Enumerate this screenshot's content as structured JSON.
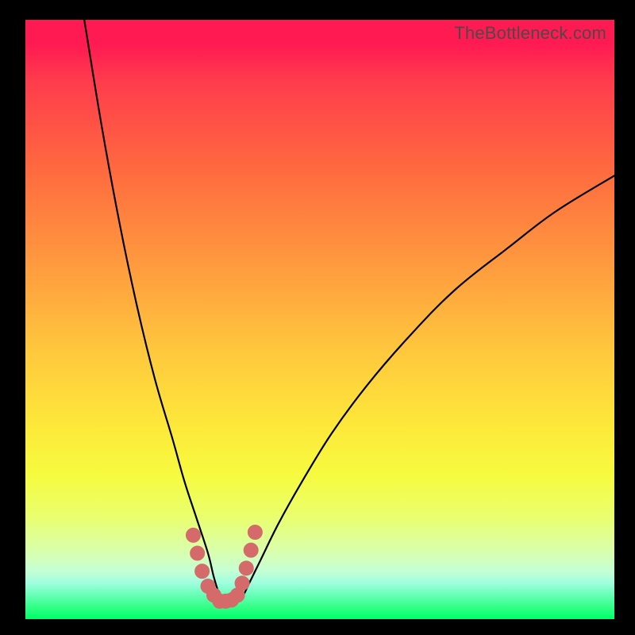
{
  "watermark": {
    "text": "TheBottleneck.com"
  },
  "colors": {
    "curve_stroke": "#000000",
    "marker_fill": "#d46a6a",
    "marker_stroke": "#d46a6a"
  },
  "chart_data": {
    "type": "line",
    "title": "",
    "xlabel": "",
    "ylabel": "",
    "xlim": [
      0,
      100
    ],
    "ylim": [
      0,
      100
    ],
    "grid": false,
    "legend": false,
    "note": "Values expressed in percent of plot area; x to the right, y upward from bottom. The black curve is a V-shaped bottleneck curve with its minimum near x≈33.",
    "series": [
      {
        "name": "bottleneck-curve",
        "x": [
          10,
          13,
          16,
          19,
          22,
          25,
          27,
          29,
          31,
          32,
          33,
          34,
          35,
          36,
          37,
          38,
          40,
          43,
          47,
          52,
          58,
          65,
          73,
          82,
          90,
          100
        ],
        "y": [
          100,
          82,
          66,
          52,
          40,
          30,
          23,
          17,
          11,
          7,
          4,
          3,
          3,
          3,
          4,
          6,
          10,
          16,
          23,
          31,
          39,
          47,
          55,
          62,
          68,
          74
        ]
      }
    ],
    "markers": {
      "name": "highlight-points",
      "x": [
        28.5,
        29.2,
        30.0,
        31.0,
        32.0,
        33.0,
        34.0,
        35.0,
        36.0,
        36.8,
        37.5,
        38.3,
        39.0
      ],
      "y": [
        14.0,
        11.0,
        8.0,
        5.5,
        4.0,
        3.0,
        3.0,
        3.2,
        4.0,
        6.0,
        8.5,
        11.5,
        14.5
      ]
    }
  }
}
